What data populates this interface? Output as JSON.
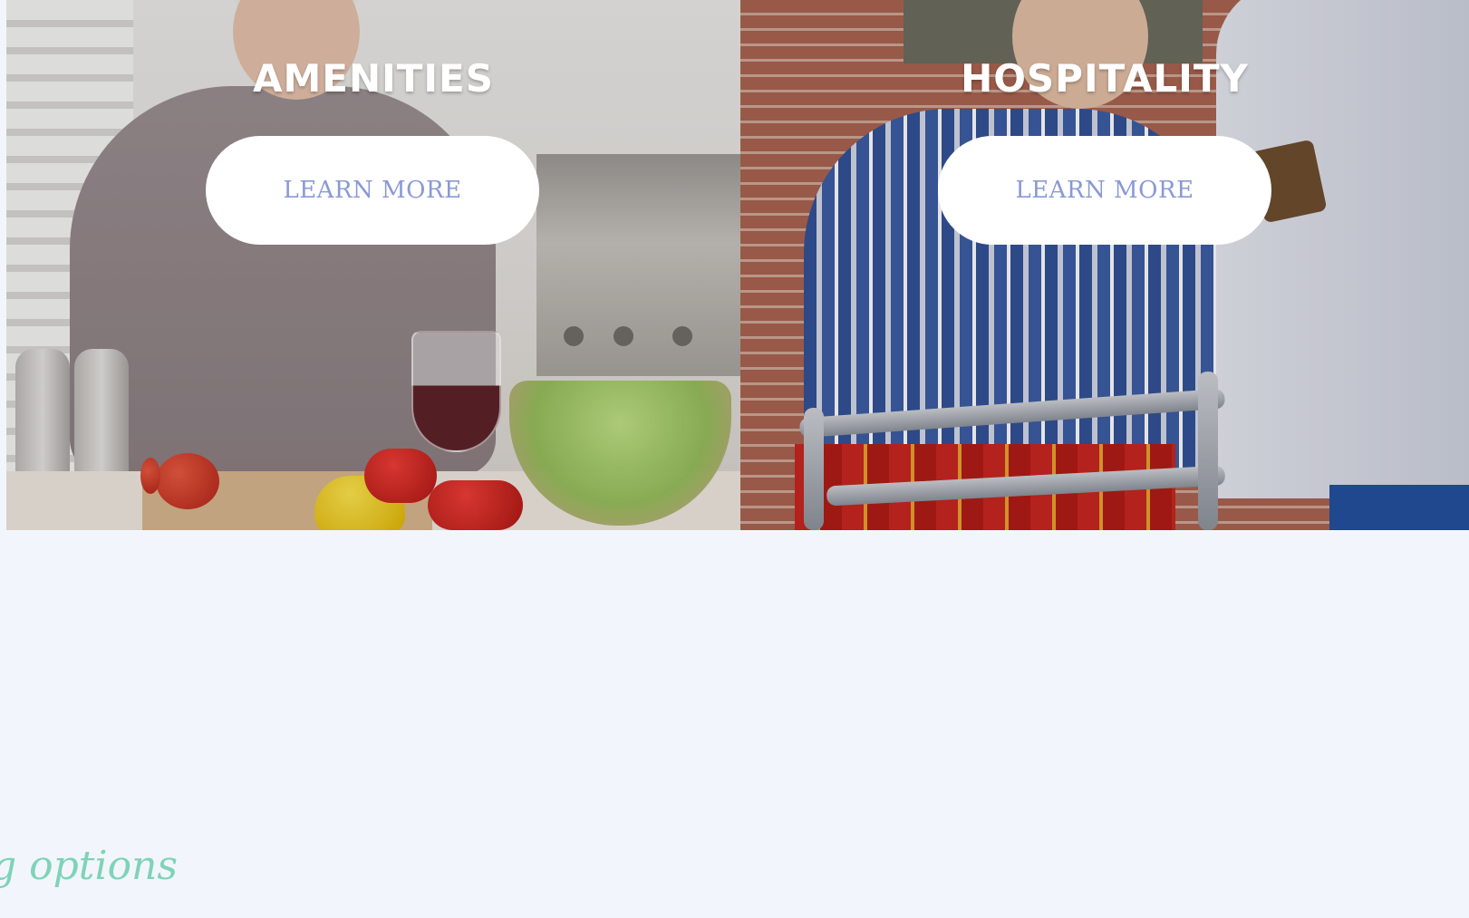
{
  "cards": [
    {
      "title": "AMENITIES",
      "button_label": "LEARN MORE",
      "image": "senior woman preparing salad in kitchen"
    },
    {
      "title": "HOSPITALITY",
      "button_label": "LEARN MORE",
      "image": "senior man with walker assisted by caregiver"
    }
  ],
  "section_heading_partial": "g options",
  "colors": {
    "page_background": "#f2f6fc",
    "button_background": "#ffffff",
    "button_text": "#8a99d6",
    "heading_accent": "#7fd3b7",
    "card_title": "#ffffff"
  }
}
